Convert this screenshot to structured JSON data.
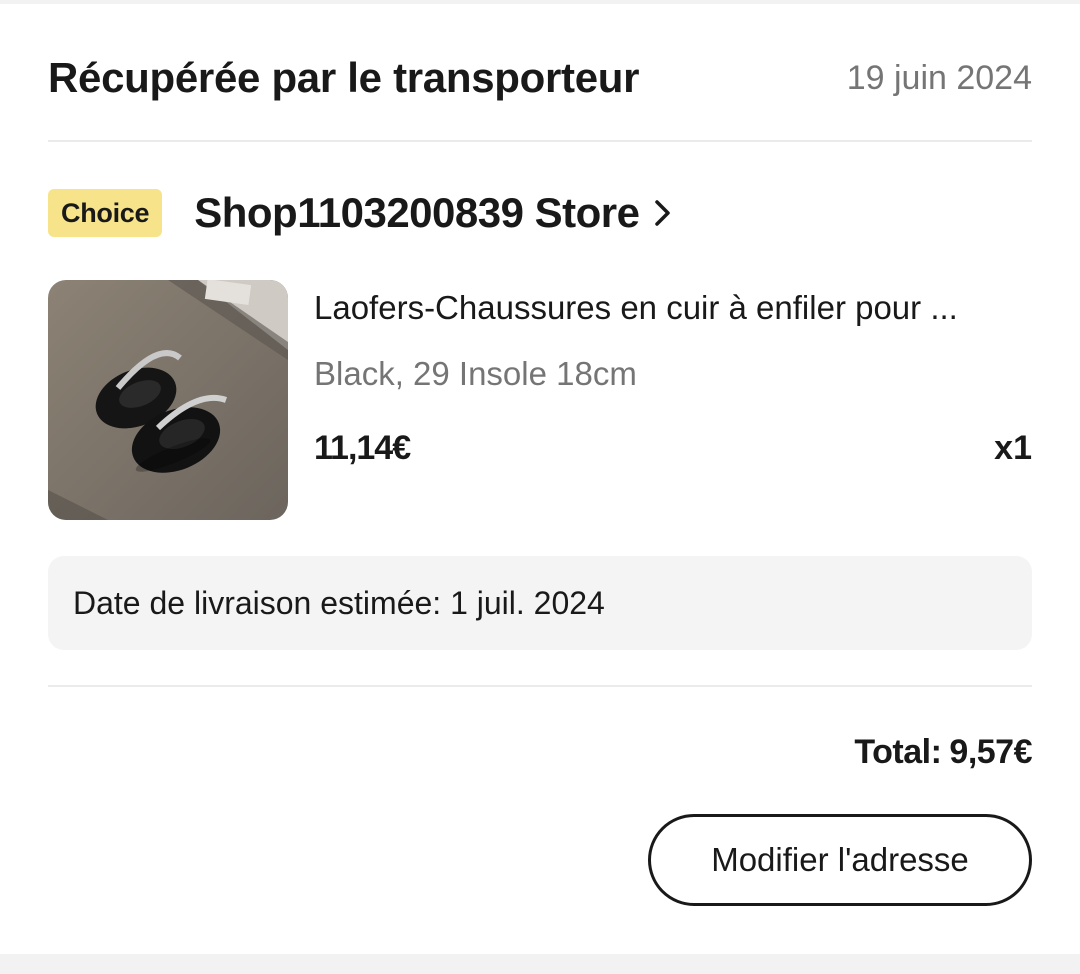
{
  "status": {
    "title": "Récupérée par le transporteur",
    "date": "19 juin 2024"
  },
  "store": {
    "badge": "Choice",
    "name": "Shop1103200839 Store",
    "chevron_icon": "chevron-right-icon"
  },
  "product": {
    "title": "Laofers-Chaussures en cuir à enfiler pour ...",
    "variant": "Black, 29 Insole 18cm",
    "price": "11,14€",
    "quantity": "x1",
    "image": "black-leather-shoes-photo"
  },
  "delivery": {
    "text": "Date de livraison estimée: 1 juil. 2024"
  },
  "total": {
    "label": "Total:",
    "value": "9,57€"
  },
  "actions": {
    "modify_address": "Modifier l'adresse"
  },
  "colors": {
    "badge_bg": "#f7e48a",
    "text": "#191919",
    "muted": "#757575",
    "box_bg": "#f4f4f4"
  }
}
